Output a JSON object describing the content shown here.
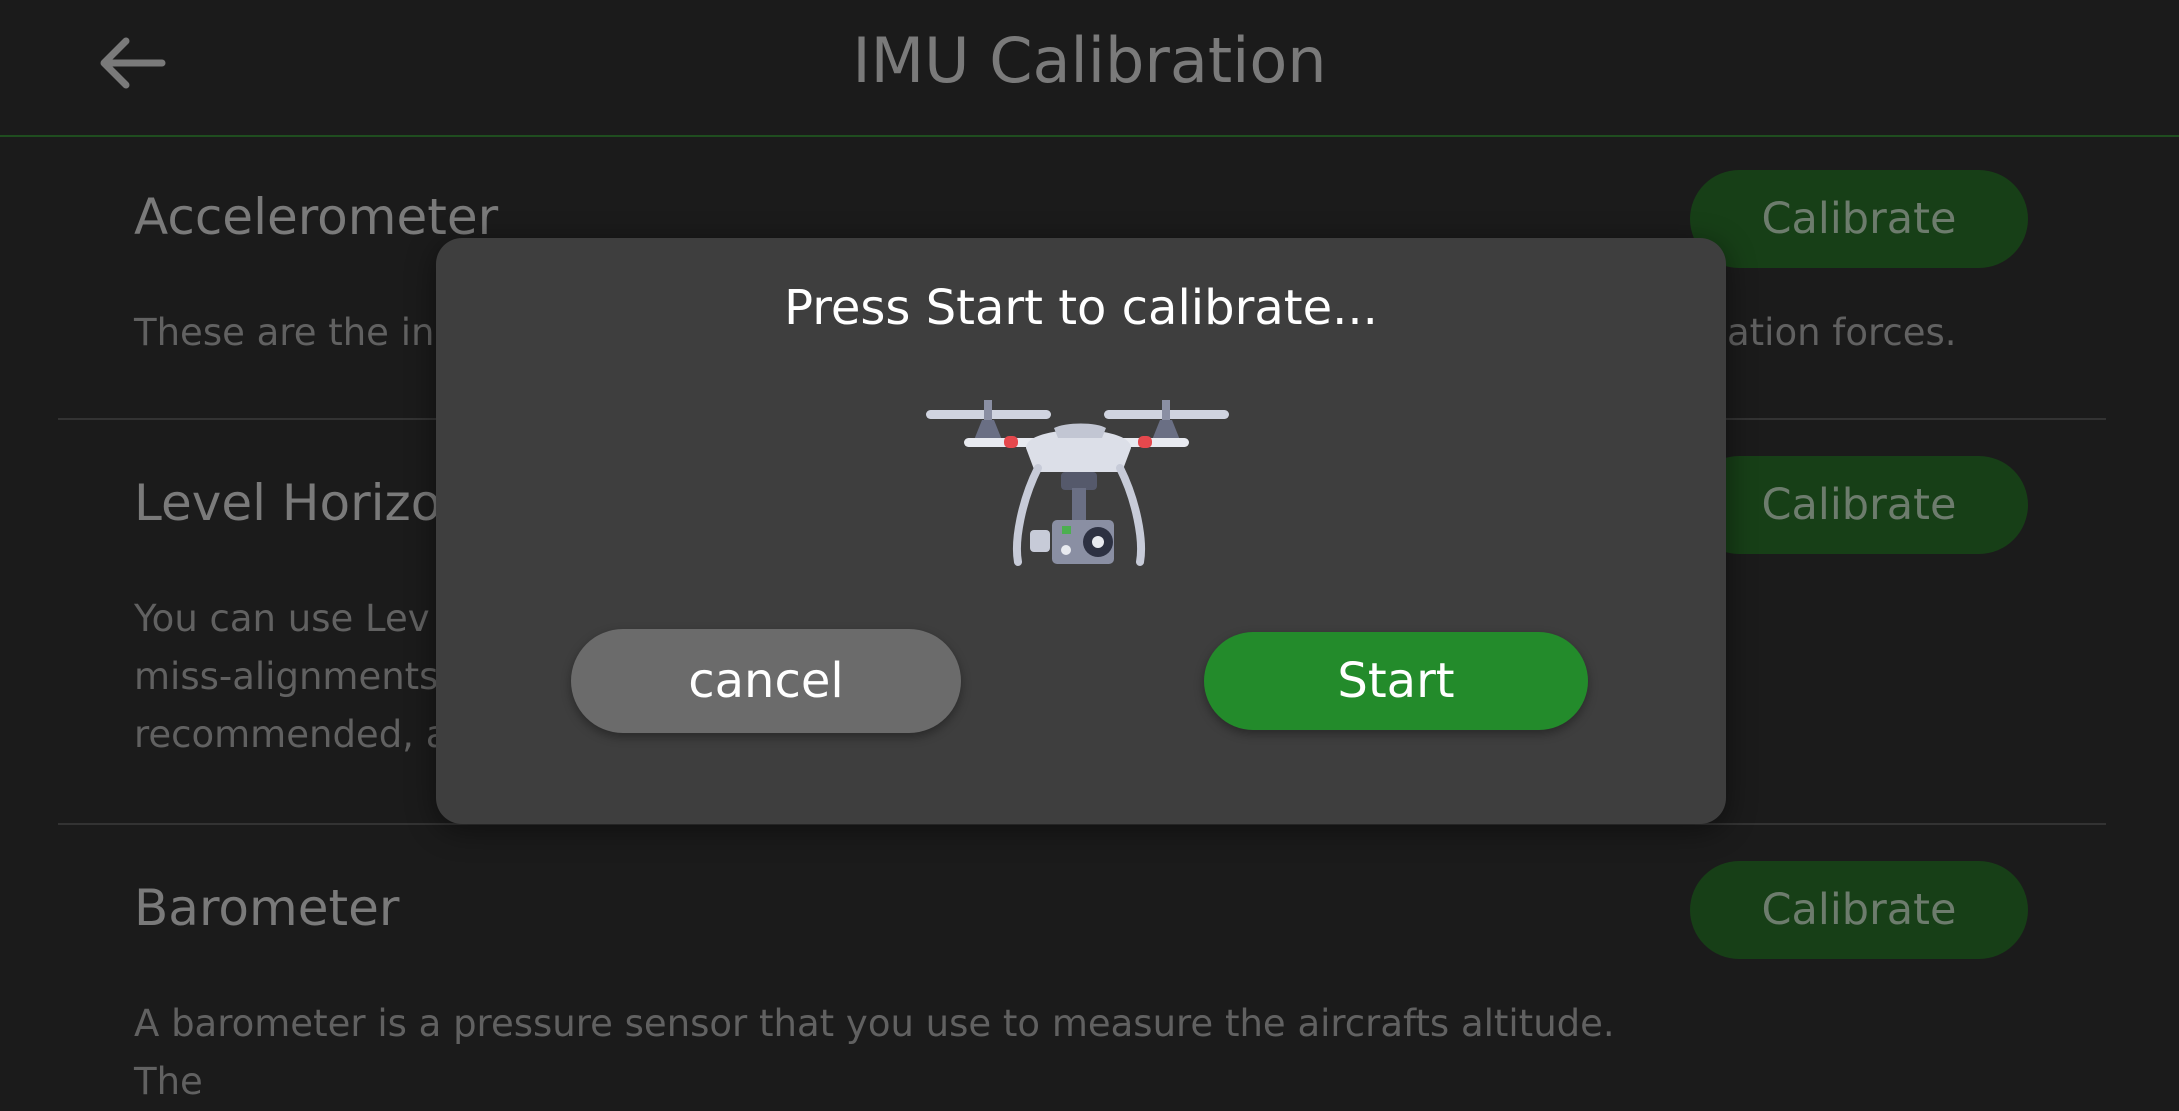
{
  "header": {
    "title": "IMU Calibration",
    "back_icon": "arrow-left-icon"
  },
  "sections": [
    {
      "title": "Accelerometer",
      "description_lines": [
        "These are the in",
        "ation forces."
      ],
      "button_label": "Calibrate"
    },
    {
      "title": "Level Horizor",
      "description_lines": [
        "You can use Lev",
        "miss-alignments",
        "recommended, a"
      ],
      "button_label": "Calibrate"
    },
    {
      "title": "Barometer",
      "description_lines": [
        "A barometer is a pressure sensor that you use to measure the aircrafts altitude.",
        "The"
      ],
      "button_label": "Calibrate"
    }
  ],
  "modal": {
    "message": "Press Start to calibrate...",
    "illustration": "drone-icon",
    "cancel_label": "cancel",
    "start_label": "Start"
  },
  "colors": {
    "background": "#1b1b1b",
    "modal": "#3e3e3e",
    "accent_green": "#238b2b",
    "calibrate_button": "#173f17"
  }
}
